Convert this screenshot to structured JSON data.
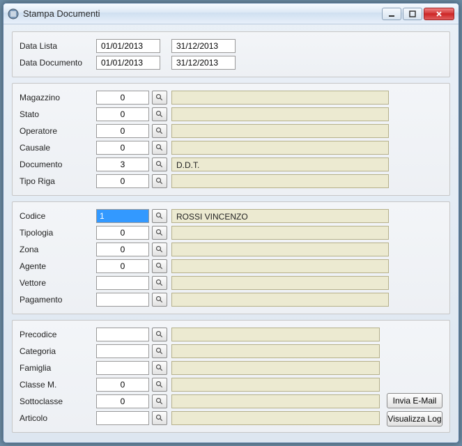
{
  "window": {
    "title": "Stampa Documenti"
  },
  "dates": {
    "lista_label": "Data Lista",
    "lista_from": "01/01/2013",
    "lista_to": "31/12/2013",
    "doc_label": "Data Documento",
    "doc_from": "01/01/2013",
    "doc_to": "31/12/2013"
  },
  "g2": {
    "magazzino": {
      "label": "Magazzino",
      "code": "0",
      "desc": ""
    },
    "stato": {
      "label": "Stato",
      "code": "0",
      "desc": ""
    },
    "operatore": {
      "label": "Operatore",
      "code": "0",
      "desc": ""
    },
    "causale": {
      "label": "Causale",
      "code": "0",
      "desc": ""
    },
    "documento": {
      "label": "Documento",
      "code": "3",
      "desc": "D.D.T."
    },
    "tiporiga": {
      "label": "Tipo Riga",
      "code": "0",
      "desc": ""
    }
  },
  "g3": {
    "codice": {
      "label": "Codice",
      "code": "1",
      "desc": "ROSSI VINCENZO"
    },
    "tipologia": {
      "label": "Tipologia",
      "code": "0",
      "desc": ""
    },
    "zona": {
      "label": "Zona",
      "code": "0",
      "desc": ""
    },
    "agente": {
      "label": "Agente",
      "code": "0",
      "desc": ""
    },
    "vettore": {
      "label": "Vettore",
      "code": "",
      "desc": ""
    },
    "pagamento": {
      "label": "Pagamento",
      "code": "",
      "desc": ""
    }
  },
  "g4": {
    "precodice": {
      "label": "Precodice",
      "code": "",
      "desc": ""
    },
    "categoria": {
      "label": "Categoria",
      "code": "",
      "desc": ""
    },
    "famiglia": {
      "label": "Famiglia",
      "code": "",
      "desc": ""
    },
    "classem": {
      "label": "Classe M.",
      "code": "0",
      "desc": ""
    },
    "sottoclasse": {
      "label": "Sottoclasse",
      "code": "0",
      "desc": ""
    },
    "articolo": {
      "label": "Articolo",
      "code": "",
      "desc": ""
    }
  },
  "buttons": {
    "email": "Invia E-Mail",
    "log": "Visualizza Log"
  }
}
